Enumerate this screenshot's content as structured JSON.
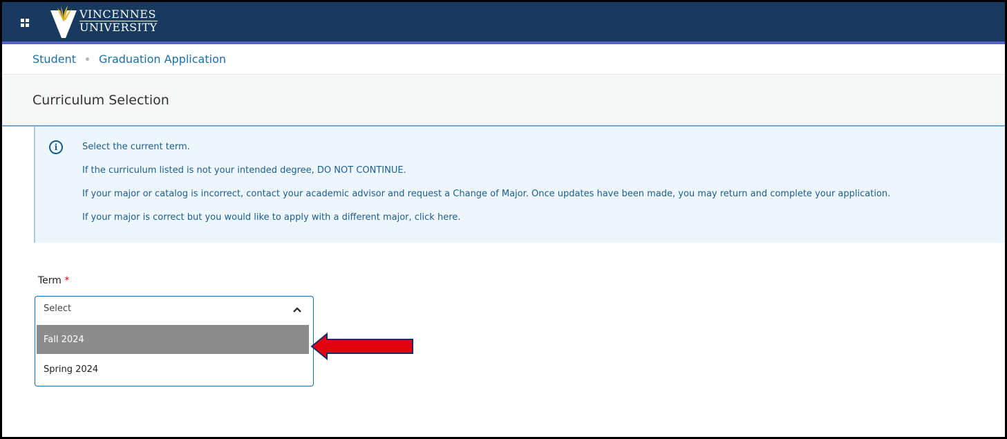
{
  "header": {
    "apps_icon": "apps-grid-icon",
    "logo_line1": "VINCENNES",
    "logo_line2": "UNIVERSITY",
    "colors": {
      "bar": "#173a5e",
      "accent_line": "#5a5fc9"
    }
  },
  "breadcrumb": {
    "items": [
      "Student",
      "Graduation Application"
    ]
  },
  "page": {
    "title": "Curriculum Selection"
  },
  "info": {
    "icon": "info-icon",
    "lines": [
      "Select the current term.",
      "If the curriculum listed is not your intended degree, DO NOT CONTINUE.",
      "If your major or catalog is incorrect, contact your academic advisor and request a Change of Major. Once updates have been made, you may return and complete your application.",
      "If your major is correct but you would like to apply with a different major, click here."
    ]
  },
  "term_field": {
    "label": "Term",
    "required_mark": "*",
    "placeholder": "Select",
    "options": [
      "Fall 2024",
      "Spring 2024"
    ],
    "highlighted_option": "Fall 2024"
  },
  "annotation": {
    "arrow_color": "#e3000f"
  }
}
